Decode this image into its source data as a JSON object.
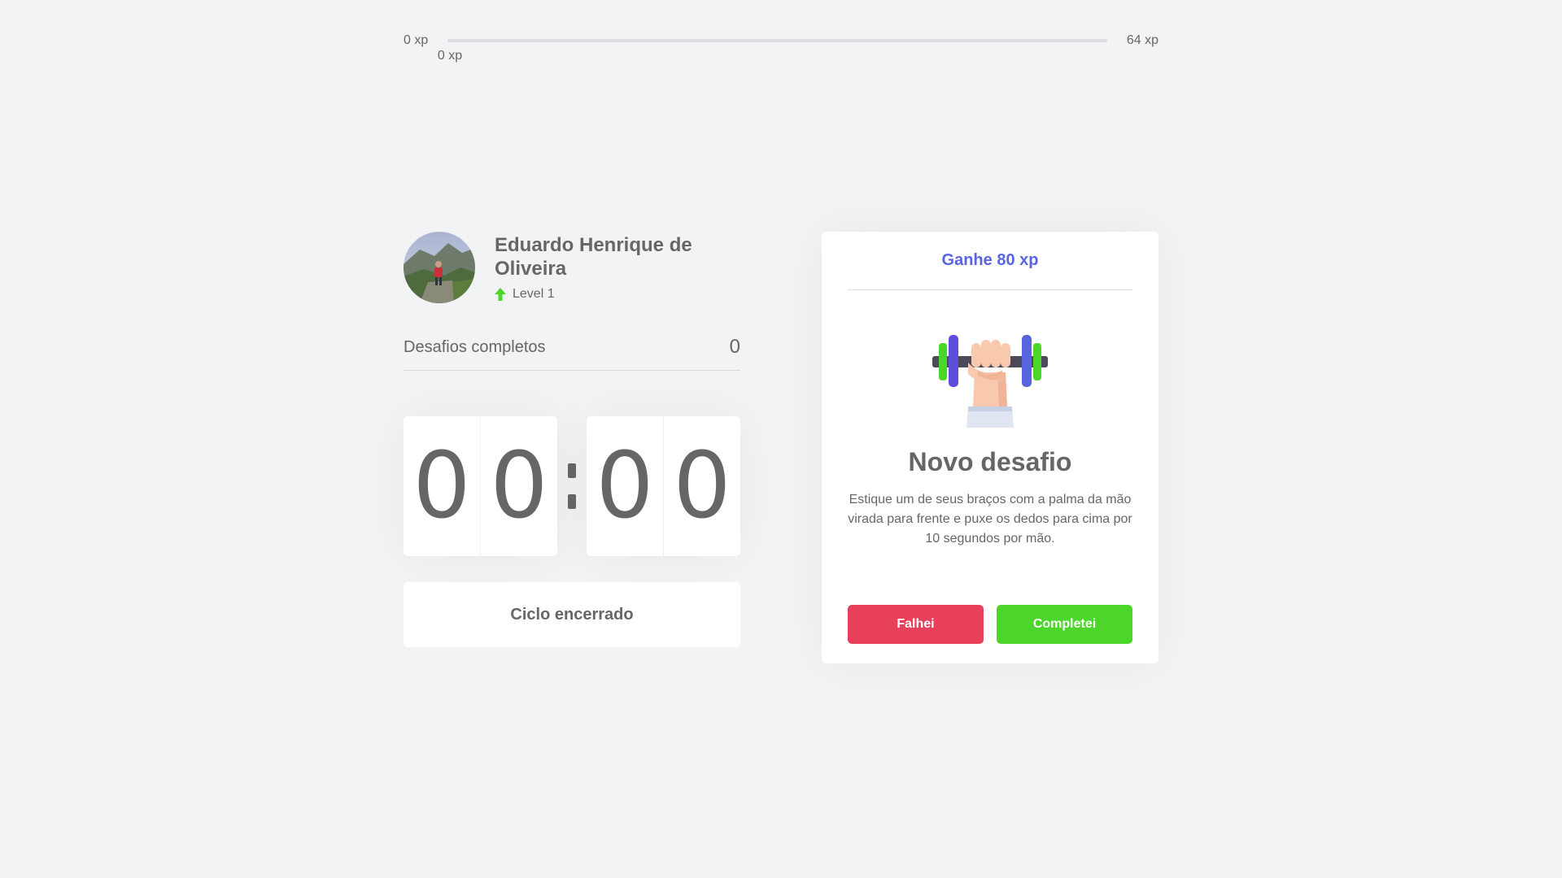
{
  "xp": {
    "min_label": "0 xp",
    "max_label": "64 xp",
    "current_label": "0 xp",
    "progress_fraction": 0.0
  },
  "profile": {
    "name": "Eduardo Henrique de Oliveira",
    "level": "Level 1",
    "level_icon": "level-up-arrow-icon"
  },
  "challenges": {
    "label": "Desafios completos",
    "value": "0"
  },
  "countdown": {
    "minute_left": "0",
    "minute_right": "0",
    "second_left": "0",
    "second_right": "0"
  },
  "cycle_button": {
    "label": "Ciclo encerrado"
  },
  "challenge_card": {
    "header": "Ganhe 80 xp",
    "icon": "dumbbell-hand-icon",
    "title": "Novo desafio",
    "description": "Estique um de seus braços com a palma da mão virada para frente e puxe os dedos para cima por 10 segundos por mão.",
    "fail_label": "Falhei",
    "success_label": "Completei"
  },
  "colors": {
    "background": "#f2f3f5",
    "text": "#666666",
    "accent": "#5965e0",
    "red": "#e83f5b",
    "green": "#4cd62b"
  }
}
